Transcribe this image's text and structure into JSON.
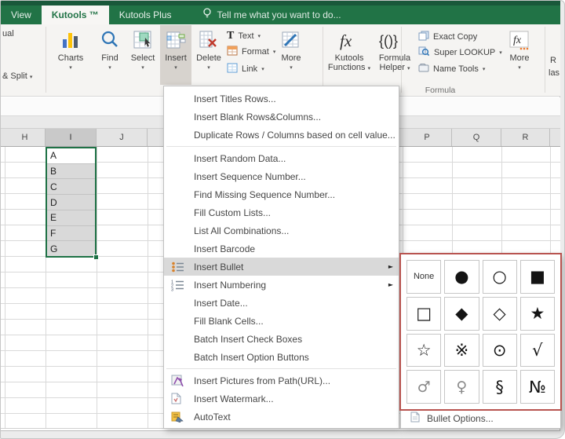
{
  "titlebar": {
    "search_hint": "Tell me what you want to do...",
    "search_icon": "lightbulb-icon"
  },
  "tabs": [
    {
      "label": "View",
      "active": false
    },
    {
      "label": "Kutools ™",
      "active": true
    },
    {
      "label": "Kutools Plus",
      "active": false
    }
  ],
  "ribbon": {
    "fragments": {
      "top_left": "ual",
      "mid_left": "& Split",
      "right_top": "R",
      "right_bottom": "las"
    },
    "buttons": {
      "charts": {
        "label": "Charts",
        "icon": "bar-chart-icon"
      },
      "find": {
        "label": "Find",
        "icon": "magnifier-icon"
      },
      "select": {
        "label": "Select",
        "icon": "select-cells-icon"
      },
      "insert": {
        "label": "Insert",
        "icon": "insert-cells-icon",
        "active": true
      },
      "delete": {
        "label": "Delete",
        "icon": "delete-cells-icon"
      },
      "text": {
        "label": "Text",
        "icon": "text-icon"
      },
      "format": {
        "label": "Format",
        "icon": "format-table-icon"
      },
      "link": {
        "label": "Link",
        "icon": "link-table-icon"
      },
      "more_left": {
        "label": "More",
        "icon": "chart-pencil-icon"
      },
      "kutools_functions": {
        "label": "Kutools Functions",
        "icon": "fx-icon"
      },
      "formula_helper": {
        "label": "Formula Helper",
        "icon": "braces-icon"
      },
      "exact_copy": {
        "label": "Exact Copy",
        "icon": "copy-icon"
      },
      "super_lookup": {
        "label": "Super LOOKUP",
        "icon": "lookup-magnifier-icon"
      },
      "name_tools": {
        "label": "Name Tools",
        "icon": "name-tools-icon"
      },
      "more_right": {
        "label": "More",
        "icon": "fx-more-icon"
      }
    },
    "group_label": "Formula"
  },
  "sheet": {
    "left_columns": [
      "H",
      "I",
      "J"
    ],
    "right_columns": [
      "P",
      "Q",
      "R"
    ],
    "selected_column": "I",
    "selection_values": [
      "A",
      "B",
      "C",
      "D",
      "E",
      "F",
      "G"
    ]
  },
  "insert_menu": {
    "items": [
      {
        "label": "Insert Titles Rows..."
      },
      {
        "label": "Insert Blank Rows&Columns..."
      },
      {
        "label": "Duplicate Rows / Columns based on cell value...",
        "sep_after": true
      },
      {
        "label": "Insert Random Data..."
      },
      {
        "label": "Insert Sequence Number..."
      },
      {
        "label": "Find Missing Sequence Number..."
      },
      {
        "label": "Fill Custom Lists..."
      },
      {
        "label": "List All Combinations..."
      },
      {
        "label": "Insert Barcode"
      },
      {
        "label": "Insert Bullet",
        "icon": "bullet-list-icon",
        "submenu": true,
        "highlight": true
      },
      {
        "label": "Insert Numbering",
        "icon": "numbered-list-icon",
        "submenu": true
      },
      {
        "label": "Insert Date..."
      },
      {
        "label": "Fill Blank Cells..."
      },
      {
        "label": "Batch Insert Check Boxes"
      },
      {
        "label": "Batch Insert Option Buttons",
        "sep_after": true
      },
      {
        "label": "Insert Pictures from Path(URL)...",
        "icon": "insert-picture-icon"
      },
      {
        "label": "Insert Watermark...",
        "icon": "watermark-icon"
      },
      {
        "label": "AutoText",
        "icon": "autotext-icon"
      }
    ]
  },
  "bullet_submenu": {
    "cells": [
      {
        "label": "None",
        "kind": "text"
      },
      {
        "symbol": "●"
      },
      {
        "symbol": "○"
      },
      {
        "symbol": "■"
      },
      {
        "symbol": "□"
      },
      {
        "symbol": "◆"
      },
      {
        "symbol": "◇"
      },
      {
        "symbol": "★"
      },
      {
        "symbol": "☆"
      },
      {
        "symbol": "※"
      },
      {
        "symbol": "⊙"
      },
      {
        "symbol": "√"
      },
      {
        "symbol": "♂",
        "muted": true
      },
      {
        "symbol": "♀",
        "muted": true
      },
      {
        "symbol": "§"
      },
      {
        "symbol": "№"
      }
    ],
    "footer": "Bullet Options...",
    "footer_icon": "bullet-options-icon",
    "annotation_border_color": "#b85450"
  },
  "colors": {
    "excel_green": "#217346",
    "annotation_red": "#b85450",
    "selection_green": "#1e7145"
  }
}
